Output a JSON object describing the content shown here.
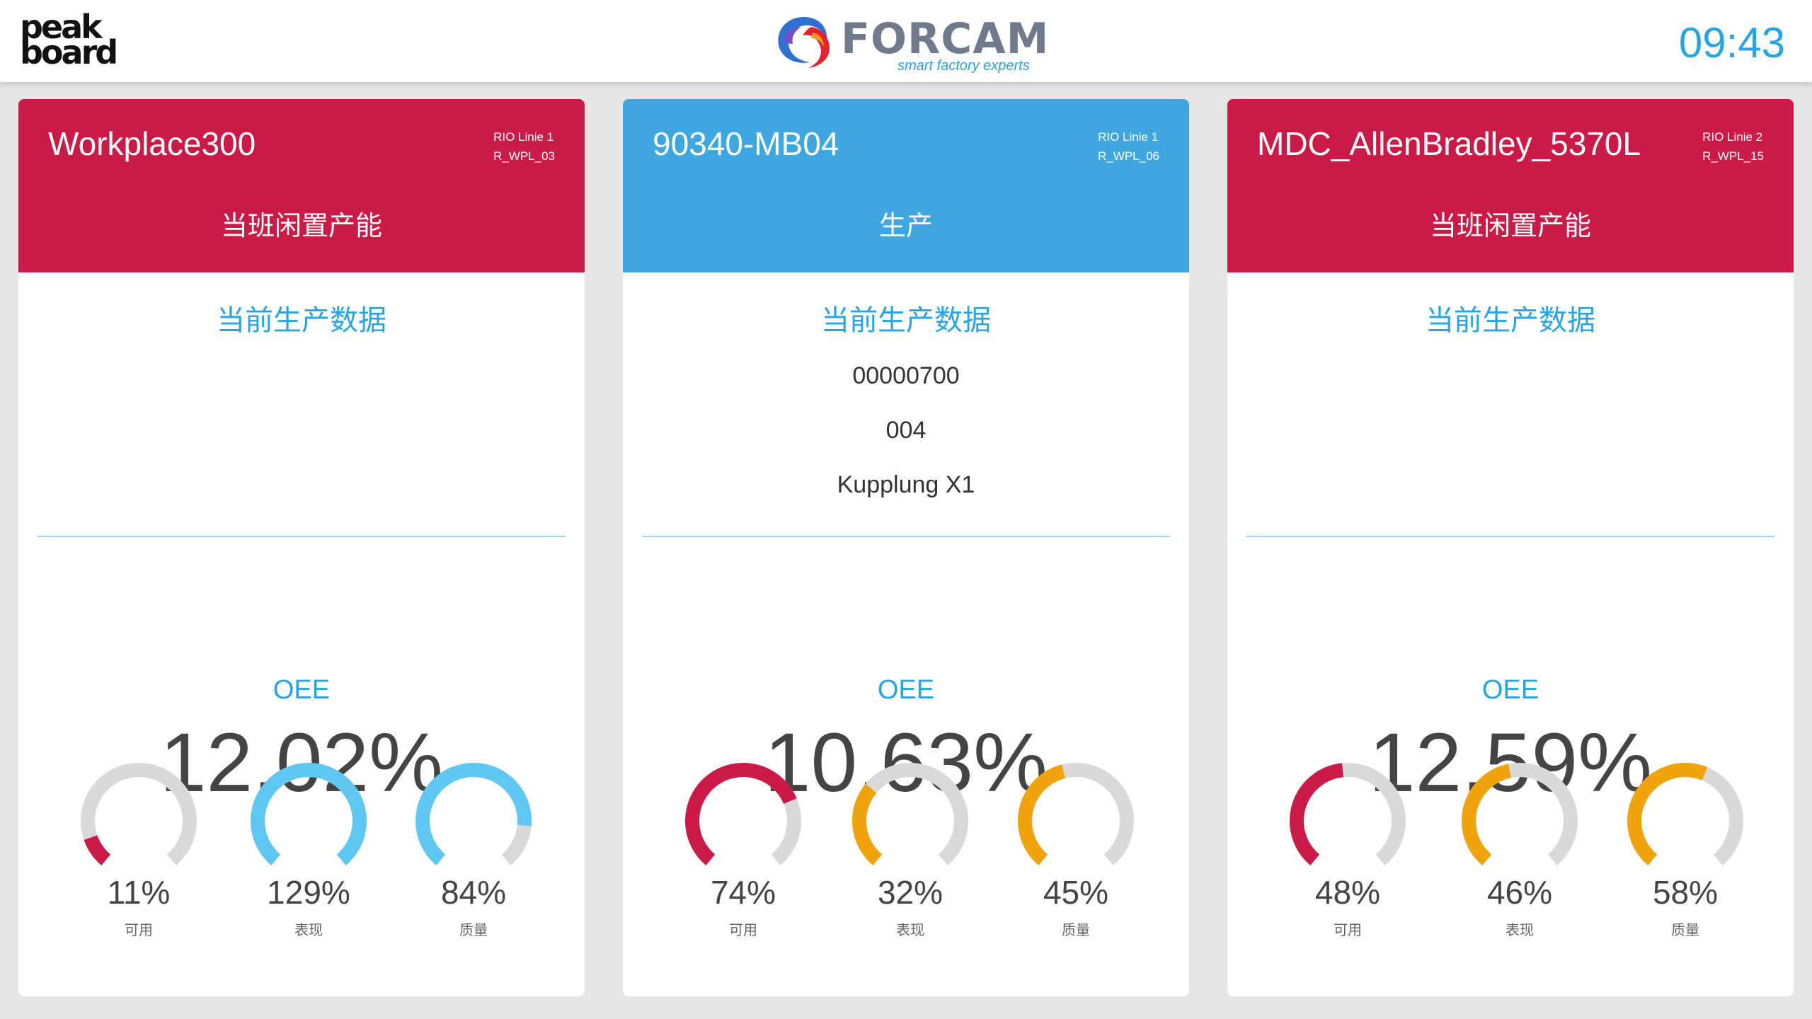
{
  "header": {
    "logo_left": [
      "peak",
      "board"
    ],
    "brand": "FORCAM",
    "brand_tagline": "smart factory experts",
    "clock": "09:43"
  },
  "colors": {
    "red": "#cc1a47",
    "blue": "#3ea7e0",
    "gauge_blue": "#5ec8f2",
    "orange": "#f0a30a",
    "track": "#d9d9d9",
    "accent_text": "#29a4e2"
  },
  "section_title": "当前生产数据",
  "oee_label": "OEE",
  "cards": [
    {
      "name": "Workplace300",
      "line": "RIO Linie 1",
      "code": "R_WPL_03",
      "status": "当班闲置产能",
      "header_color": "#cc1a47",
      "production": [
        "",
        "",
        ""
      ],
      "oee": "12.02%",
      "gauges": [
        {
          "value": "11%",
          "label": "可用",
          "fraction": 0.11,
          "color": "#cc1a47"
        },
        {
          "value": "129%",
          "label": "表现",
          "fraction": 1.0,
          "color": "#5ec8f2"
        },
        {
          "value": "84%",
          "label": "质量",
          "fraction": 0.84,
          "color": "#5ec8f2"
        }
      ]
    },
    {
      "name": "90340-MB04",
      "line": "RIO Linie 1",
      "code": "R_WPL_06",
      "status": "生产",
      "header_color": "#3ea7e0",
      "production": [
        "00000700",
        "004",
        "Kupplung X1"
      ],
      "oee": "10.63%",
      "gauges": [
        {
          "value": "74%",
          "label": "可用",
          "fraction": 0.74,
          "color": "#cc1a47"
        },
        {
          "value": "32%",
          "label": "表现",
          "fraction": 0.32,
          "color": "#f0a30a"
        },
        {
          "value": "45%",
          "label": "质量",
          "fraction": 0.45,
          "color": "#f0a30a"
        }
      ]
    },
    {
      "name": "MDC_AllenBradley_5370L",
      "line": "RIO Linie 2",
      "code": "R_WPL_15",
      "status": "当班闲置产能",
      "header_color": "#cc1a47",
      "production": [
        "",
        "",
        ""
      ],
      "oee": "12.59%",
      "gauges": [
        {
          "value": "48%",
          "label": "可用",
          "fraction": 0.48,
          "color": "#cc1a47"
        },
        {
          "value": "46%",
          "label": "表现",
          "fraction": 0.46,
          "color": "#f0a30a"
        },
        {
          "value": "58%",
          "label": "质量",
          "fraction": 0.58,
          "color": "#f0a30a"
        }
      ]
    }
  ]
}
